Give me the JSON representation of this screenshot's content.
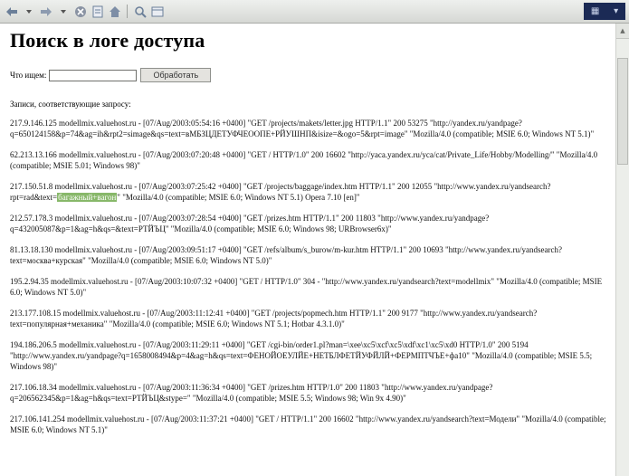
{
  "page": {
    "title": "Поиск в логе доступа",
    "search_label": "Что ищем:",
    "search_value": "",
    "submit_label": "Обработать",
    "results_heading": "Записи, соответствующие запросу:"
  },
  "toolbar": {
    "buttons": [
      "back-icon",
      "forward-icon",
      "stop-icon",
      "refresh-icon",
      "home-icon",
      "search-icon",
      "history-icon"
    ]
  },
  "entries": [
    {
      "text": "217.9.146.125 modellmix.valuehost.ru - [07/Aug/2003:05:54:16 +0400] \"GET /projects/makets/letter.jpg HTTP/1.1\" 200 53275 \"http://yandex.ru/yandpage?q=650124158&p=74&ag=ih&rpt2=simage&qs=text=вМБЗЦДЕТУФЧЕООПЕ+РЙУШНП&isize=&ogo=5&rpt=image\" \"Mozilla/4.0 (compatible; MSIE 6.0; Windows NT 5.1)\""
    },
    {
      "text": "62.213.13.166 modellmix.valuehost.ru - [07/Aug/2003:07:20:48 +0400] \"GET / HTTP/1.0\" 200 16602 \"http://yaca.yandex.ru/yca/cat/Private_Life/Hobby/Modelling/\" \"Mozilla/4.0 (compatible; MSIE 5.01; Windows 98)\""
    },
    {
      "pre": "217.150.51.8 modellmix.valuehost.ru - [07/Aug/2003:07:25:42 +0400] \"GET /projects/baggage/index.htm HTTP/1.1\" 200 12055 \"http://www.yandex.ru/yandsearch?rpt=rad&text=",
      "hl": "багажный+вагон",
      "post": "\" \"Mozilla/4.0 (compatible; MSIE 6.0; Windows NT 5.1) Opera 7.10 [en]\""
    },
    {
      "text": "212.57.178.3 modellmix.valuehost.ru - [07/Aug/2003:07:28:54 +0400] \"GET /prizes.htm HTTP/1.1\" 200 11803 \"http://www.yandex.ru/yandpage?q=432005087&p=1&ag=h&qs=&text=РТЙЪЦ\" \"Mozilla/4.0 (compatible; MSIE 6.0; Windows 98; URBrowser6x)\""
    },
    {
      "text": "81.13.18.130 modellmix.valuehost.ru - [07/Aug/2003:09:51:17 +0400] \"GET /refs/album/s_burow/m-kur.htm HTTP/1.1\" 200 10693 \"http://www.yandex.ru/yandsearch?text=москва+курская\" \"Mozilla/4.0 (compatible; MSIE 6.0; Windows NT 5.0)\""
    },
    {
      "text": "195.2.94.35 modellmix.valuehost.ru - [07/Aug/2003:10:07:32 +0400] \"GET / HTTP/1.0\" 304 - \"http://www.yandex.ru/yandsearch?text=modellmix\" \"Mozilla/4.0 (compatible; MSIE 6.0; Windows NT 5.0)\""
    },
    {
      "text": "213.177.108.15 modellmix.valuehost.ru - [07/Aug/2003:11:12:41 +0400] \"GET /projects/popmech.htm HTTP/1.1\" 200 9177 \"http://www.yandex.ru/yandsearch?text=популярная+механика\" \"Mozilla/4.0 (compatible; MSIE 6.0; Windows NT 5.1; Hotbar 4.3.1.0)\""
    },
    {
      "text": "194.186.206.5 modellmix.valuehost.ru - [07/Aug/2003:11:29:11 +0400] \"GET /cgi-bin/order1.pl?man=\\xee\\xc5\\xcf\\xc5\\xdf\\xc1\\xc5\\xd0 HTTP/1.0\" 200 5194 \"http://www.yandex.ru/yandpage?q=1658008494&p=4&ag=h&qs=text=ФЕНОЙОЕУЛЙЕ+НЕТБЛФЕТЙУФЙЛЙ+ФЕРМПТЧЪЕ+фа10\" \"Mozilla/4.0 (compatible; MSIE 5.5; Windows 98)\""
    },
    {
      "text": "217.106.18.34 modellmix.valuehost.ru - [07/Aug/2003:11:36:34 +0400] \"GET /prizes.htm HTTP/1.0\" 200 11803 \"http://www.yandex.ru/yandpage?q=206562345&p=1&ag=h&qs=text=РТЙЪЦ&stype=\" \"Mozilla/4.0 (compatible; MSIE 5.5; Windows 98; Win 9x 4.90)\""
    },
    {
      "text": "217.106.141.254 modellmix.valuehost.ru - [07/Aug/2003:11:37:21 +0400] \"GET / HTTP/1.1\" 200 16602 \"http://www.yandex.ru/yandsearch?text=Модели\" \"Mozilla/4.0 (compatible; MSIE 6.0; Windows NT 5.1)\""
    }
  ]
}
